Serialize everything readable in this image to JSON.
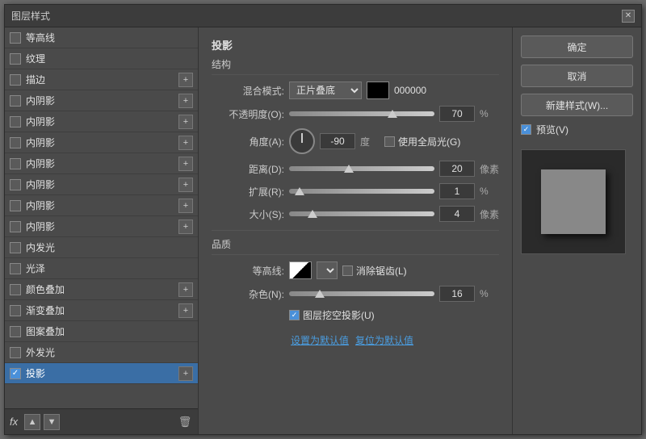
{
  "dialog": {
    "title": "图层样式",
    "close_icon": "✕"
  },
  "left_panel": {
    "items": [
      {
        "id": "equalization",
        "label": "等高线",
        "checked": false,
        "has_add": false
      },
      {
        "id": "grain",
        "label": "纹理",
        "checked": false,
        "has_add": false
      },
      {
        "id": "stroke",
        "label": "描边",
        "checked": false,
        "has_add": true
      },
      {
        "id": "inner-shadow-1",
        "label": "内阴影",
        "checked": false,
        "has_add": true
      },
      {
        "id": "inner-shadow-2",
        "label": "内阴影",
        "checked": false,
        "has_add": true
      },
      {
        "id": "inner-shadow-3",
        "label": "内阴影",
        "checked": false,
        "has_add": true
      },
      {
        "id": "inner-shadow-4",
        "label": "内阴影",
        "checked": false,
        "has_add": true
      },
      {
        "id": "inner-shadow-5",
        "label": "内阴影",
        "checked": false,
        "has_add": true
      },
      {
        "id": "inner-shadow-6",
        "label": "内阴影",
        "checked": false,
        "has_add": true
      },
      {
        "id": "inner-shadow-7",
        "label": "内阴影",
        "checked": false,
        "has_add": true
      },
      {
        "id": "inner-glow",
        "label": "内发光",
        "checked": false,
        "has_add": false
      },
      {
        "id": "gloss",
        "label": "光泽",
        "checked": false,
        "has_add": false
      },
      {
        "id": "color-overlay",
        "label": "颜色叠加",
        "checked": false,
        "has_add": true
      },
      {
        "id": "gradient-overlay",
        "label": "渐变叠加",
        "checked": false,
        "has_add": true
      },
      {
        "id": "pattern-overlay",
        "label": "图案叠加",
        "checked": false,
        "has_add": false
      },
      {
        "id": "outer-glow",
        "label": "外发光",
        "checked": false,
        "has_add": false
      },
      {
        "id": "drop-shadow",
        "label": "投影",
        "checked": true,
        "has_add": true,
        "active": true
      }
    ],
    "footer": {
      "fx_label": "fx",
      "up_icon": "▲",
      "down_icon": "▼",
      "trash_icon": "🗑"
    }
  },
  "middle_panel": {
    "section_title": "投影",
    "structure_label": "结构",
    "blend_mode_label": "混合模式:",
    "blend_mode_value": "正片叠底",
    "blend_color": "000000",
    "opacity_label": "不透明度(O):",
    "opacity_value": "70",
    "opacity_unit": "%",
    "opacity_slider_pos": "70",
    "angle_label": "角度(A):",
    "angle_value": "-90",
    "angle_unit": "度",
    "global_light_label": "使用全局光(G)",
    "global_light_checked": false,
    "distance_label": "距离(D):",
    "distance_value": "20",
    "distance_unit": "像素",
    "distance_slider_pos": "40",
    "spread_label": "扩展(R):",
    "spread_value": "1",
    "spread_unit": "%",
    "spread_slider_pos": "5",
    "size_label": "大小(S):",
    "size_value": "4",
    "size_unit": "像素",
    "size_slider_pos": "15",
    "quality_label": "品质",
    "contour_label": "等高线:",
    "anti_alias_label": "消除锯齿(L)",
    "anti_alias_checked": false,
    "noise_label": "杂色(N):",
    "noise_value": "16",
    "noise_unit": "%",
    "noise_slider_pos": "20",
    "layer_knockout_label": "图层挖空投影(U)",
    "layer_knockout_checked": true,
    "default_btn": "设置为默认值",
    "reset_btn": "复位为默认值"
  },
  "right_panel": {
    "ok_label": "确定",
    "cancel_label": "取消",
    "new_style_label": "新建样式(W)...",
    "preview_label": "预览(V)",
    "preview_checked": true
  }
}
